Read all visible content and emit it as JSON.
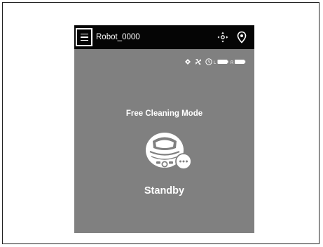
{
  "header": {
    "robot_name": "Robot_0000",
    "menu_icon": "hamburger-menu-icon",
    "remote_icon": "remote-control-icon",
    "location_icon": "location-pin-icon"
  },
  "status_bar": {
    "icons": [
      "water-icon",
      "fan-icon",
      "timer-icon",
      "battery-left-icon",
      "battery-right-icon"
    ],
    "left_battery_label": "L",
    "right_battery_label": "R"
  },
  "main": {
    "mode": "Free Cleaning Mode",
    "status": "Standby",
    "robot_icon": "robot-mower-icon",
    "more_icon": "more-options-icon"
  },
  "colors": {
    "screen_background": "#808080",
    "app_bar": "#050505",
    "text": "#ffffff"
  }
}
